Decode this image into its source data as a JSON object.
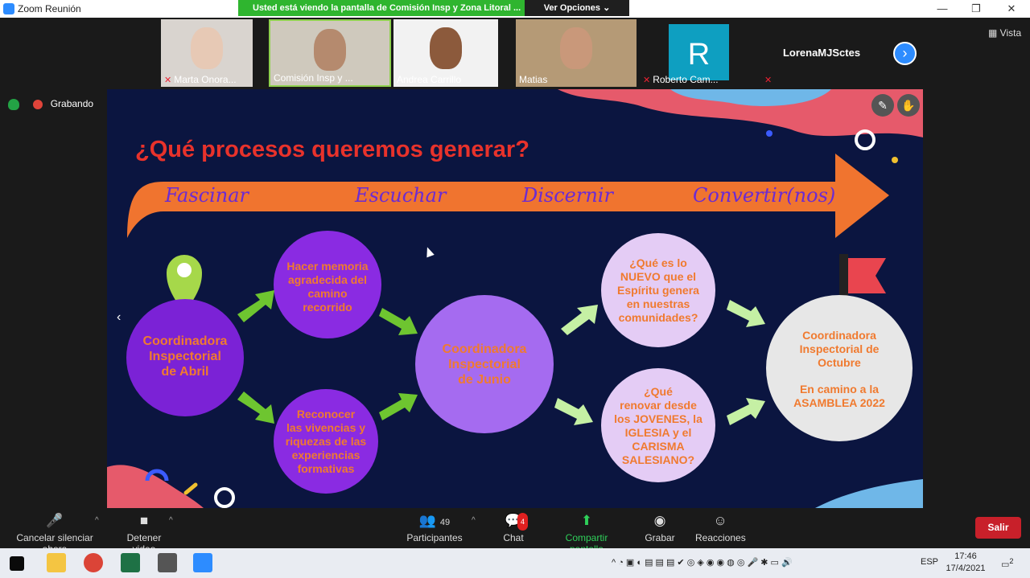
{
  "window": {
    "title": "Zoom Reunión",
    "minimize": "—",
    "restore": "❐",
    "close": "✕"
  },
  "share_banner": {
    "message": "Usted está viendo la pantalla de Comisión Insp y Zona Litoral ...",
    "options_label": "Ver Opciones ⌄"
  },
  "participants": [
    {
      "name": "Marta Onora...",
      "muted": true
    },
    {
      "name": "Comisión Insp y ...",
      "muted": false
    },
    {
      "name": "Andrea Carrillo",
      "muted": false
    },
    {
      "name": "Matias",
      "muted": false
    },
    {
      "name": "Roberto Cam...",
      "muted": true,
      "initial": "R"
    },
    {
      "name": "LorenaMJSctes",
      "muted": true
    }
  ],
  "view_label": "Vista",
  "recording_label": "Grabando",
  "slide": {
    "title": "¿Qué procesos queremos generar?",
    "arrow_words": [
      "Fascinar",
      "Escuchar",
      "Discernir",
      "Convertir(nos)"
    ],
    "circles": {
      "abril": [
        "Coordinadora",
        "Inspectorial",
        "de Abril"
      ],
      "memoria": [
        "Hacer memoria",
        "agradecida del",
        "camino",
        "recorrido"
      ],
      "vivencias": [
        "Reconocer",
        "las vivencias y",
        "riquezas de las",
        "experiencias",
        "formativas"
      ],
      "junio": [
        "Coordinadora",
        "Inspectorial",
        "de Junio"
      ],
      "nuevo": [
        "¿Qué es lo",
        "NUEVO que el",
        "Espíritu genera",
        "en nuestras",
        "comunidades?"
      ],
      "renovar": [
        "¿Qué",
        "renovar desde",
        "los JOVENES, la",
        "IGLESIA y el",
        "CARISMA",
        "SALESIANO?"
      ],
      "octubre": [
        "Coordinadora",
        "Inspectorial de",
        "Octubre",
        "",
        "En camino a la",
        "ASAMBLEA 2022"
      ]
    }
  },
  "toolbar": {
    "mute_label": "Cancelar silenciar ahora",
    "video_label": "Detener video",
    "participants_count": "49",
    "participants_label": "Participantes",
    "chat_badge": "4",
    "chat_label": "Chat",
    "share_label": "Compartir pantalla",
    "record_label": "Grabar",
    "reactions_label": "Reacciones",
    "leave_label": "Salir"
  },
  "taskbar": {
    "language": "ESP",
    "time": "17:46",
    "date": "17/4/2021",
    "notifications": "2"
  },
  "colors": {
    "slide_bg": "#0b1540",
    "title_red": "#e8322b",
    "arrow_orange": "#f0742f",
    "purple_dark": "#7b22d6",
    "purple_mid": "#a56bf0",
    "lilac": "#e4ccf5",
    "grey_circle": "#e7e7e7",
    "text_orange": "#f07a2f",
    "green_arrow": "#6ec530",
    "leave_red": "#c8202a"
  }
}
